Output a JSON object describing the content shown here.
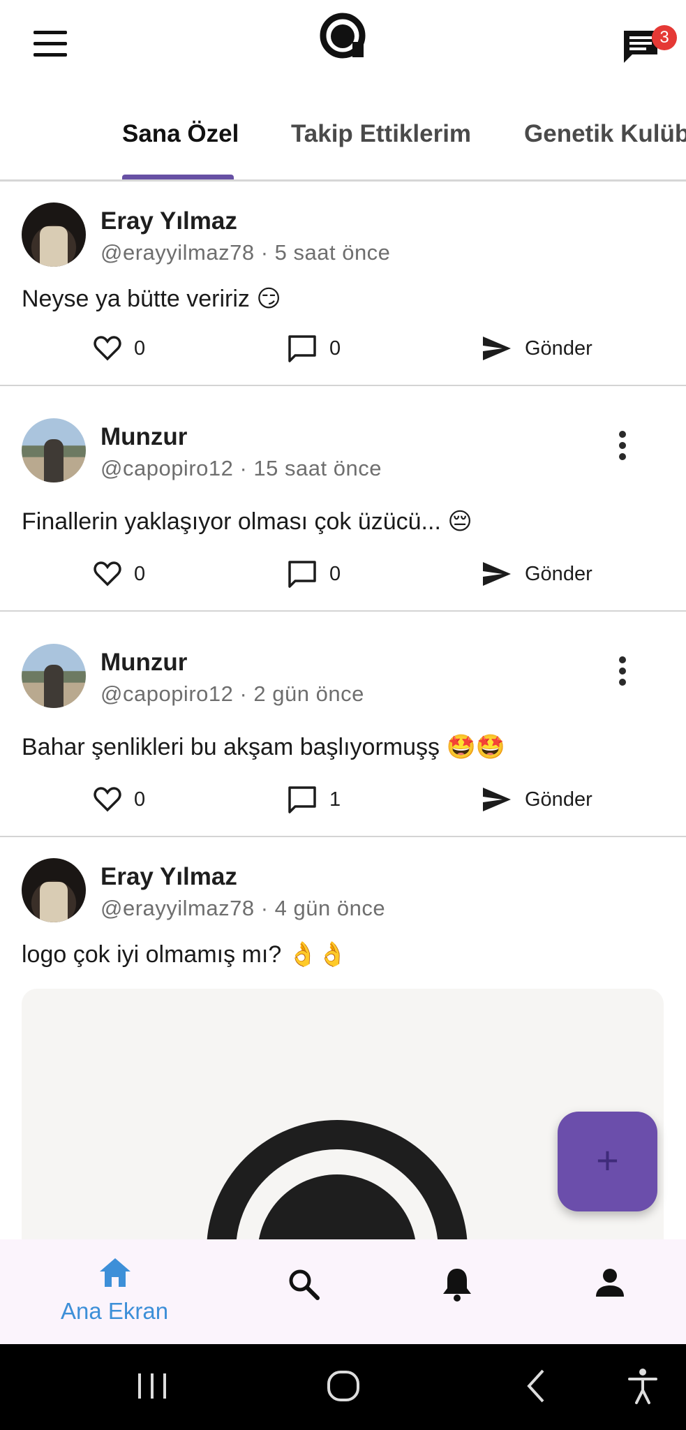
{
  "header": {
    "menu_icon": "hamburger-menu-icon",
    "logo_icon": "app-logo-icon",
    "messages_icon": "chat-icon",
    "messages_badge": "3"
  },
  "tabs": [
    {
      "label": "Sana Özel",
      "active": true
    },
    {
      "label": "Takip Ettiklerim",
      "active": false
    },
    {
      "label": "Genetik Kulübü",
      "active": false
    }
  ],
  "posts": [
    {
      "author": "Eray Yılmaz",
      "handle_time": "@erayyilmaz78 · 5 saat önce",
      "text": "Neyse ya bütte veririz 😏",
      "likes": "0",
      "comments": "0",
      "send_label": "Gönder",
      "has_menu": false
    },
    {
      "author": "Munzur",
      "handle_time": "@capopiro12 · 15 saat önce",
      "text": "Finallerin yaklaşıyor olması çok üzücü... 😔",
      "likes": "0",
      "comments": "0",
      "send_label": "Gönder",
      "has_menu": true
    },
    {
      "author": "Munzur",
      "handle_time": "@capopiro12 · 2 gün önce",
      "text": "Bahar şenlikleri bu akşam başlıyormuşş 🤩🤩",
      "likes": "0",
      "comments": "1",
      "send_label": "Gönder",
      "has_menu": true
    },
    {
      "author": "Eray Yılmaz",
      "handle_time": "@erayyilmaz78 · 4 gün önce",
      "text": "logo çok iyi olmamış mı? 👌👌",
      "has_image": true
    }
  ],
  "fab": {
    "label": "+"
  },
  "bottom_nav": [
    {
      "icon": "home-icon",
      "label": "Ana Ekran",
      "active": true
    },
    {
      "icon": "search-icon",
      "label": "",
      "active": false
    },
    {
      "icon": "bell-icon",
      "label": "",
      "active": false
    },
    {
      "icon": "profile-icon",
      "label": "",
      "active": false
    }
  ],
  "colors": {
    "accent": "#6750a4",
    "fab": "#6b4eab",
    "nav_active": "#3d8fd8",
    "badge": "#e53935",
    "nav_bg": "#fbf4fc"
  }
}
